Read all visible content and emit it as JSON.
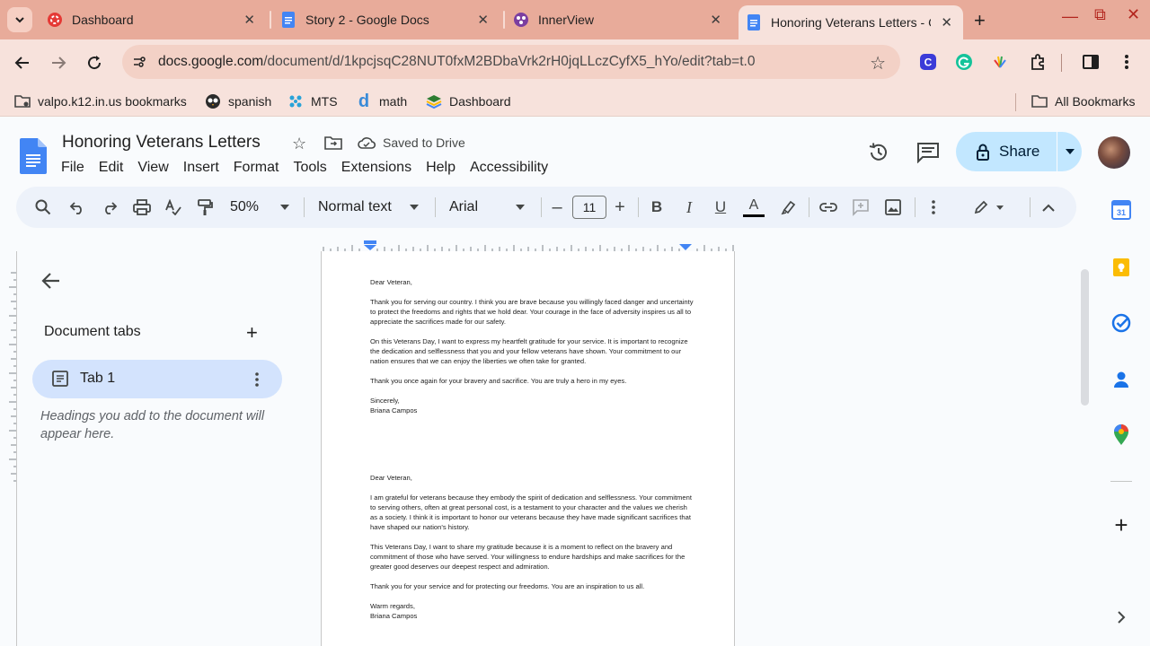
{
  "browser": {
    "tabs": [
      {
        "title": "Dashboard",
        "active": false
      },
      {
        "title": "Story 2 - Google Docs",
        "active": false
      },
      {
        "title": "InnerView",
        "active": false
      },
      {
        "title": "Honoring Veterans Letters - G",
        "active": true
      }
    ],
    "url_host": "docs.google.com",
    "url_path": "/document/d/1kpcjsqC28NUT0fxM2BDbaVrk2rH0jqLLczCyfX5_hYo/edit?tab=t.0",
    "bookmarks": [
      "valpo.k12.in.us bookmarks",
      "spanish",
      "MTS",
      "math",
      "Dashboard"
    ],
    "all_bookmarks": "All Bookmarks"
  },
  "doc": {
    "title": "Honoring Veterans Letters",
    "saved_status": "Saved to Drive",
    "menu": [
      "File",
      "Edit",
      "View",
      "Insert",
      "Format",
      "Tools",
      "Extensions",
      "Help",
      "Accessibility"
    ],
    "share_label": "Share"
  },
  "toolbar": {
    "zoom": "50%",
    "style": "Normal text",
    "font": "Arial",
    "font_size": "11"
  },
  "sidebar": {
    "title": "Document tabs",
    "tab_label": "Tab 1",
    "hint": "Headings you add to the document will appear here."
  },
  "letters": [
    {
      "salutation": "Dear Veteran,",
      "paragraphs": [
        "Thank you for serving our country. I think you are brave because you willingly faced danger and uncertainty to protect the freedoms and rights that we hold dear. Your courage in the face of adversity inspires us all to appreciate the sacrifices made for our safety.",
        "On this Veterans Day, I want to express my heartfelt gratitude for your service. It is important to recognize the dedication and selflessness that you and your fellow veterans have shown. Your commitment to our nation ensures that we can enjoy the liberties we often take for granted.",
        "Thank you once again for your bravery and sacrifice. You are truly a hero in my eyes."
      ],
      "closing": "Sincerely,",
      "signature": "Briana Campos"
    },
    {
      "salutation": "Dear Veteran,",
      "paragraphs": [
        "I am grateful for veterans because they embody the spirit of dedication and selflessness. Your commitment to serving others, often at great personal cost, is a testament to your character and the values we cherish as a society. I think it is important to honor our veterans because they have made significant sacrifices that have shaped our nation's history.",
        "This Veterans Day, I want to share my gratitude because it is a moment to reflect on the bravery and commitment of those who have served. Your willingness to endure hardships and make sacrifices for the greater good deserves our deepest respect and admiration.",
        "Thank you for your service and for protecting our freedoms. You are an inspiration to us all."
      ],
      "closing": "Warm regards,",
      "signature": "Briana Campos"
    }
  ]
}
